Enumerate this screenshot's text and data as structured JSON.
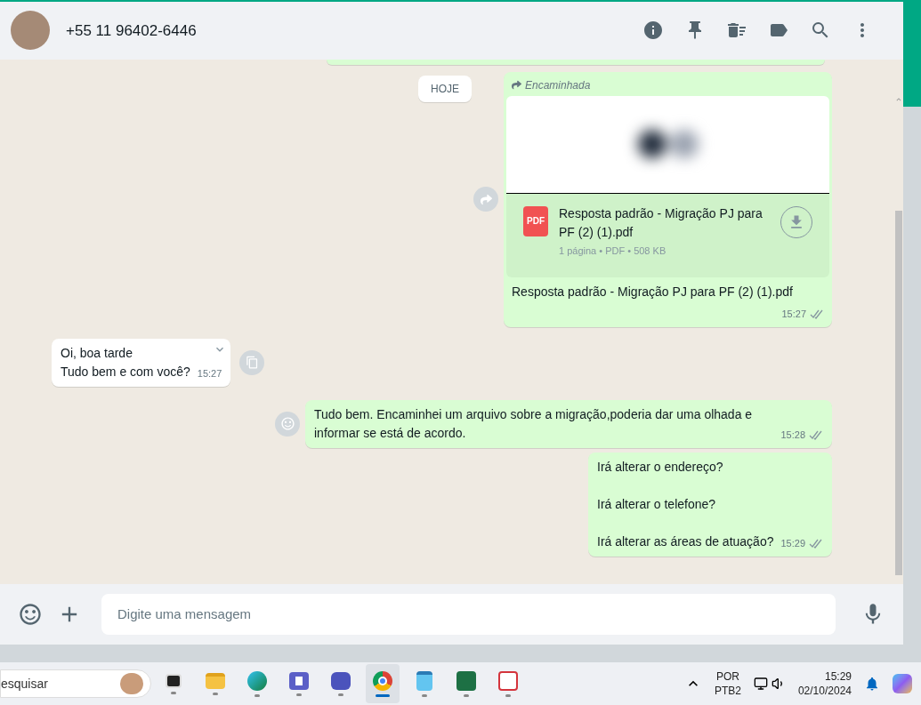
{
  "header": {
    "contact": "+55 11 96402-6446"
  },
  "date_chip": "HOJE",
  "messages": [
    {
      "kind": "document",
      "forwarded_label": "Encaminhada",
      "file_name": "Resposta padrão - Migração PJ para PF (2) (1).pdf",
      "file_type": "PDF",
      "file_meta": "1 página • PDF • 508 KB",
      "caption": "Resposta padrão - Migração PJ para PF (2) (1).pdf",
      "time": "15:27",
      "outgoing": true
    },
    {
      "kind": "text",
      "lines": [
        "Oi, boa tarde",
        "Tudo bem e com você?"
      ],
      "time": "15:27",
      "outgoing": false
    },
    {
      "kind": "text",
      "lines": [
        "Tudo bem. Encaminhei um arquivo sobre a migração,poderia dar uma olhada e informar se está de acordo."
      ],
      "time": "15:28",
      "outgoing": true
    },
    {
      "kind": "paragraphs",
      "lines": [
        "Irá alterar o endereço?",
        "Irá alterar o telefone?",
        "Irá alterar as áreas de atuação?"
      ],
      "time": "15:29",
      "outgoing": true
    }
  ],
  "composer": {
    "placeholder": "Digite uma mensagem"
  },
  "taskbar": {
    "search": "esquisar",
    "apps": [
      {
        "kind": "taskview",
        "selected": false
      },
      {
        "kind": "files",
        "selected": false
      },
      {
        "kind": "edge",
        "selected": false
      },
      {
        "kind": "teams",
        "selected": false
      },
      {
        "kind": "teams2",
        "selected": false
      },
      {
        "kind": "chrome",
        "selected": true
      },
      {
        "kind": "notepad",
        "selected": false
      },
      {
        "kind": "excel",
        "selected": false
      },
      {
        "kind": "snip",
        "selected": false
      }
    ],
    "language": [
      "POR",
      "PTB2"
    ],
    "time": "15:29",
    "date": "02/10/2024"
  }
}
